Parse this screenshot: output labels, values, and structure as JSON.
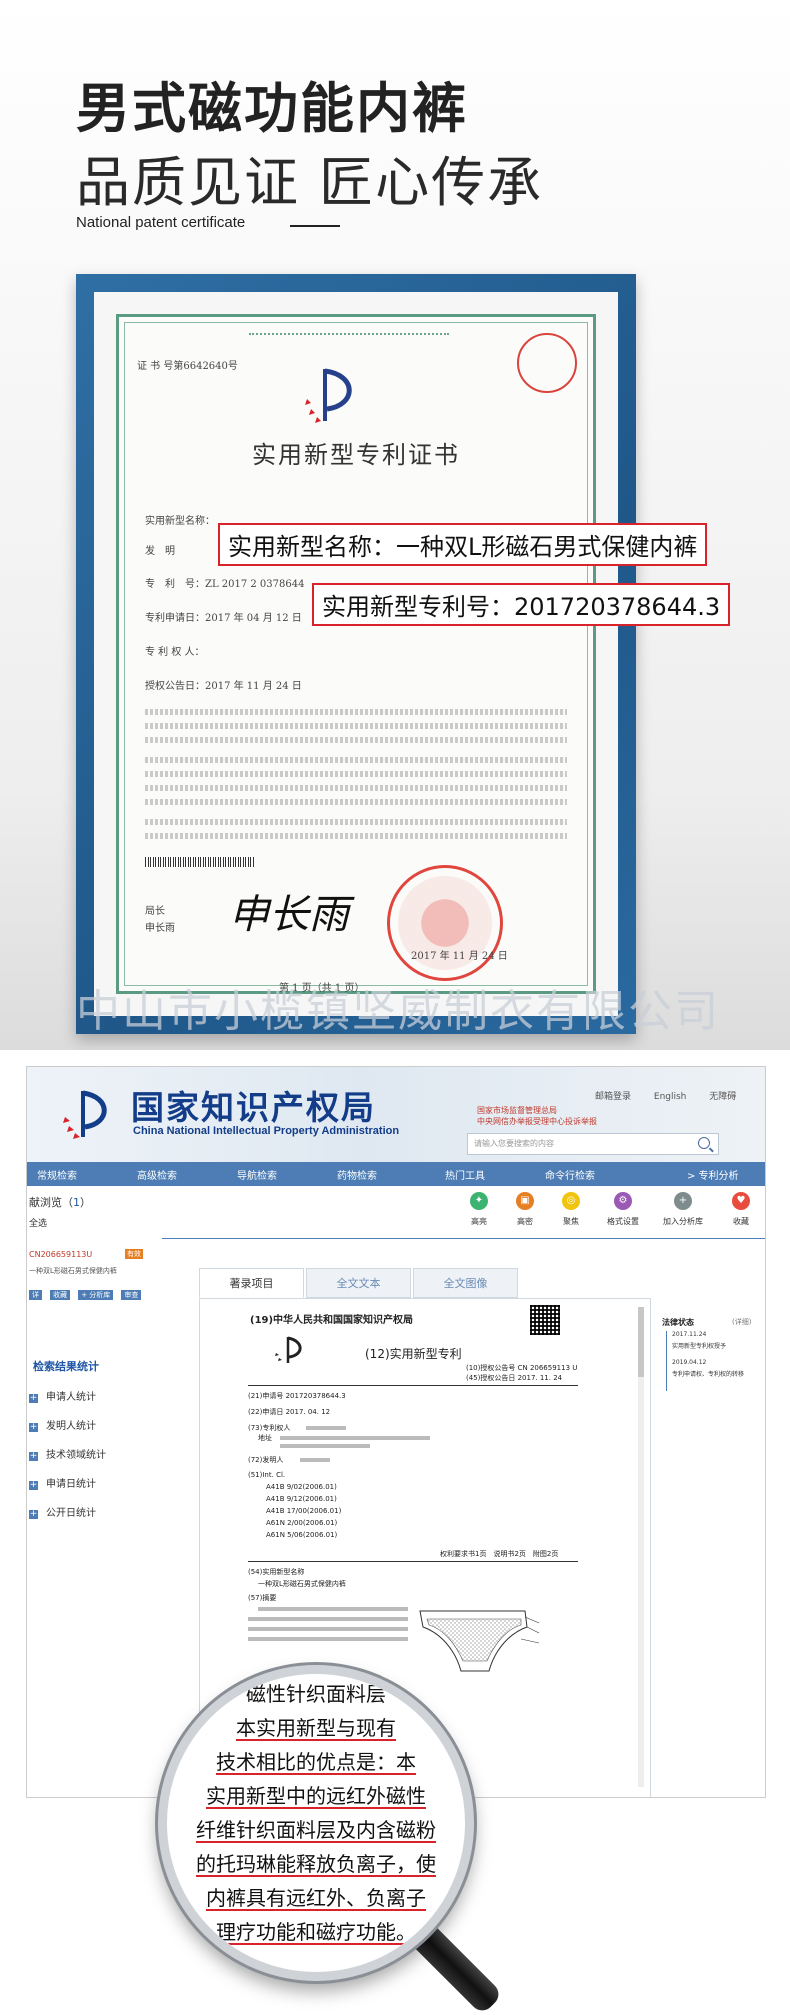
{
  "header": {
    "title_line1": "男式磁功能内裤",
    "title_line2": "品质见证 匠心传承",
    "subtitle": "National patent certificate"
  },
  "certificate": {
    "cert_no": "证 书 号第6642640号",
    "title": "实用新型专利证书",
    "field_type": "实用新型名称：",
    "field_inventor": "发　明",
    "field_patent_no": "专　利　号：ZL 2017 2 0378644",
    "field_apply_date": "专利申请日：2017 年 04 月 12 日",
    "field_owner": "专 利 权 人：",
    "field_grant_date": "授权公告日：2017 年 11 月 24 日",
    "director_label": "局长",
    "director_name": "申长雨",
    "signature": "申长雨",
    "seal_date": "2017 年 11 月 24 日",
    "page": "第 1 页（共 1 页）"
  },
  "annotations": {
    "name_label": "实用新型名称：一种双L形磁石男式保健内裤",
    "number_label": "实用新型专利号：201720378644.3"
  },
  "watermark": "中山市小榄镇坚威制衣有限公司",
  "portal": {
    "org_cn": "国家知识产权局",
    "org_en": "China National Intellectual Property Administration",
    "top_links": [
      "邮箱登录",
      "English",
      "无障碍"
    ],
    "red_notice_1": "国家市场监督管理总局",
    "red_notice_2": "中央网信办举报受理中心投诉举报",
    "search_placeholder": "请输入您要搜索的内容",
    "nav": [
      "常规检索",
      "高级检索",
      "导航检索",
      "药物检索",
      "热门工具",
      "命令行检索",
      "> 专利分析"
    ],
    "result_title": "献浏览（",
    "result_count": "1",
    "result_close": "）",
    "select_all": "全选",
    "tools": [
      {
        "label": "高亮",
        "color": "#3cb371"
      },
      {
        "label": "高密",
        "color": "#e67e22"
      },
      {
        "label": "聚焦",
        "color": "#f1c40f"
      },
      {
        "label": "格式设置",
        "color": "#9b59b6"
      },
      {
        "label": "加入分析库",
        "color": "#7f8c8d"
      },
      {
        "label": "收藏",
        "color": "#e74c3c"
      }
    ],
    "sidebar": {
      "item_title": "CN206659113U",
      "item_badge": "有效",
      "item_desc": "一种双L形磁石男式保健内裤",
      "item_buttons": [
        "详",
        "收藏",
        "+ 分析库",
        "审查"
      ],
      "stats_title": "检索结果统计",
      "stats": [
        "申请人统计",
        "发明人统计",
        "技术领域统计",
        "申请日统计",
        "公开日统计"
      ]
    },
    "tabs": [
      "著录项目",
      "全文文本",
      "全文图像"
    ],
    "doc": {
      "authority": "(19)中华人民共和国国家知识产权局",
      "kind": "(12)实用新型专利",
      "pub_no": "(10)授权公告号 CN 206659113 U",
      "pub_date": "(45)授权公告日 2017. 11. 24",
      "app_no": "(21)申请号 201720378644.3",
      "app_date": "(22)申请日 2017. 04. 12",
      "owner_label": "(73)专利权人",
      "address_label": "地址",
      "inventor_label": "(72)发明人",
      "int_cl": "(51)Int. Cl.",
      "cl_items": [
        "A41B 9/02(2006.01)",
        "A41B 9/12(2006.01)",
        "A41B 17/00(2006.01)",
        "A61N 2/00(2006.01)",
        "A61N 5/06(2006.01)"
      ],
      "pages_note": "权利要求书1页　说明书2页　附图2页",
      "name_label": "(54)实用新型名称",
      "name_value": "一种双L形磁石男式保健内裤",
      "abstract_label": "(57)摘要"
    },
    "legal": {
      "title": "法律状态",
      "more": "(详细)",
      "items": [
        "2017.11.24",
        "实用新型专利权授予",
        "2019.04.12",
        "专利申请权、专利权的转移"
      ]
    }
  },
  "magnifier": {
    "lines": [
      "磁性针织面料层",
      "本实用新型与现有",
      "技术相比的优点是：本",
      "实用新型中的远红外磁性",
      "纤维针织面料层及内含磁粉",
      "的托玛琳能释放负离子，使",
      "内裤具有远红外、负离子",
      "理疗功能和磁疗功能。"
    ]
  }
}
